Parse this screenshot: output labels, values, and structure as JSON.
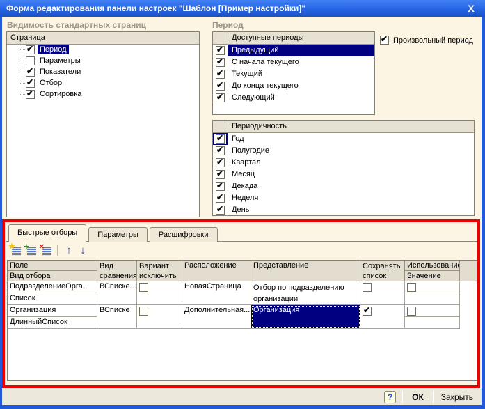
{
  "colors": {
    "titlebar_blue": "#2765E4",
    "window_border": "#2159D8",
    "content_bg": "#FCF5E4",
    "selection_bg": "#000080",
    "annotation_red": "#EE0000",
    "header_cell_bg": "#E2DDCE"
  },
  "window": {
    "title": "Форма редактирования панели настроек \"Шаблон [Пример настройки]\""
  },
  "icons": {
    "close": "X",
    "new_badge": "★",
    "add_badge": "+",
    "delete_badge": "×",
    "move_up": "↑",
    "move_down": "↓"
  },
  "visibility_panel": {
    "group_label": "Видимость стандартных страниц",
    "tree_header": "Страница",
    "items": [
      {
        "label": "Период",
        "checked": true,
        "selected": true
      },
      {
        "label": "Параметры",
        "checked": false,
        "selected": false
      },
      {
        "label": "Показатели",
        "checked": true,
        "selected": false
      },
      {
        "label": "Отбор",
        "checked": true,
        "selected": false
      },
      {
        "label": "Сортировка",
        "checked": true,
        "selected": false
      }
    ]
  },
  "period_panel": {
    "group_label": "Период",
    "arbitrary_period_label": "Произвольный период",
    "arbitrary_period_checked": true,
    "available_periods": {
      "header": "Доступные периоды",
      "items": [
        {
          "label": "Предыдущий",
          "checked": true,
          "selected": true
        },
        {
          "label": "С начала текущего",
          "checked": true,
          "selected": false
        },
        {
          "label": "Текущий",
          "checked": true,
          "selected": false
        },
        {
          "label": "До конца текущего",
          "checked": true,
          "selected": false
        },
        {
          "label": "Следующий",
          "checked": true,
          "selected": false
        }
      ]
    },
    "periodicity": {
      "header": "Периодичность",
      "items": [
        {
          "label": "Год",
          "checked": true,
          "focused": true
        },
        {
          "label": "Полугодие",
          "checked": true,
          "focused": false
        },
        {
          "label": "Квартал",
          "checked": true,
          "focused": false
        },
        {
          "label": "Месяц",
          "checked": true,
          "focused": false
        },
        {
          "label": "Декада",
          "checked": true,
          "focused": false
        },
        {
          "label": "Неделя",
          "checked": true,
          "focused": false
        },
        {
          "label": "День",
          "checked": true,
          "focused": false
        }
      ]
    }
  },
  "selections_panel": {
    "tabs": [
      {
        "label": "Быстрые отборы",
        "active": true
      },
      {
        "label": "Параметры",
        "active": false
      },
      {
        "label": "Расшифровки",
        "active": false
      }
    ],
    "table": {
      "headers": {
        "field_top": "Поле",
        "field_bottom": "Вид отбора",
        "comparison": "Вид сравнения",
        "exclude": "Вариант исключить",
        "location": "Расположение",
        "presentation": "Представление",
        "save_list": "Сохранять список",
        "usage_top": "Использование",
        "usage_bottom": "Значение"
      },
      "rows": [
        {
          "field": "ПодразделениеОрга...",
          "selection_kind": "Список",
          "comparison": "ВСписке...",
          "exclude_checked": false,
          "location": "НоваяСтраница",
          "presentation": "Отбор по подразделению организации",
          "presentation_selected": false,
          "save_list_checked": false,
          "usage_checked": false,
          "value": ""
        },
        {
          "field": "Организация",
          "selection_kind": "ДлинныйСписок",
          "comparison": "ВСписке",
          "exclude_checked": false,
          "location": "Дополнительная...",
          "presentation": "Организация",
          "presentation_selected": true,
          "save_list_checked": true,
          "usage_checked": false,
          "value": ""
        }
      ]
    }
  },
  "footer": {
    "help_label": "?",
    "ok_label": "ОК",
    "close_label": "Закрыть"
  }
}
